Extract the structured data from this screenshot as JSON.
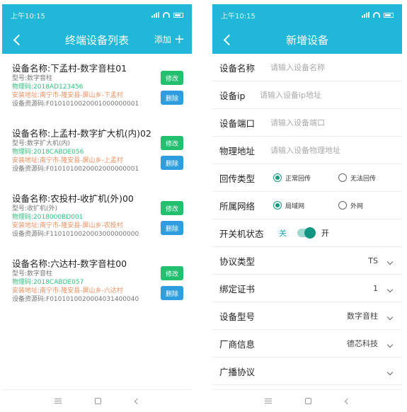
{
  "left": {
    "status_time": "上午10:15",
    "title": "终端设备列表",
    "add_label": "添加",
    "edit_label": "修改",
    "delete_label": "删除",
    "devices": [
      {
        "name": "设备名称:下孟村-数字音柱01",
        "model": "型号:数字音柱",
        "mac": "物理码:2018AD123456",
        "address": "安装地址:南宁市-隆安县-屏山乡-下孟村",
        "resource": "设备资源码:F0101010020001000000001"
      },
      {
        "name": "设备名称:上孟村-数字扩大机(内)02",
        "model": "型号:数字扩大机(内)",
        "mac": "物理码:2018CABDE056",
        "address": "安装地址:南宁市-隆安县-屏山乡-上孟村",
        "resource": "设备资源码:F0101010020002000000001"
      },
      {
        "name": "设备名称:农投村-收扩机(外)00",
        "model": "型号:收扩机(外)",
        "mac": "物理码:2018000BD001",
        "address": "安装地址:南宁市-隆安县-屏山乡-农投村",
        "resource": "设备资源码:F1101010020003000000000"
      },
      {
        "name": "设备名称:六达村-数字音柱00",
        "model": "型号:数字音柱",
        "mac": "物理码:2018CABDE057",
        "address": "安装地址:南宁市-隆安县-屏山乡-六达村",
        "resource": "设备资源码:F0101010020004031400040"
      }
    ]
  },
  "right": {
    "status_time": "上午10:15",
    "title": "新增设备",
    "fields": {
      "name": {
        "label": "设备名称",
        "placeholder": "请输入设备名称"
      },
      "ip": {
        "label": "设备ip",
        "placeholder": "请输入设备ip地址"
      },
      "port": {
        "label": "设备端口",
        "placeholder": "请输入设备端口"
      },
      "mac": {
        "label": "物理地址",
        "placeholder": "请输入设备物理地址"
      }
    },
    "feedback": {
      "label": "回传类型",
      "option_a": "正常回传",
      "option_b": "无法回传",
      "selected": "正常回传"
    },
    "network": {
      "label": "所属网络",
      "option_a": "局域网",
      "option_b": "外网",
      "selected": "局域网"
    },
    "power": {
      "label": "开关机状态",
      "off_label": "关",
      "on_label": "开",
      "state": "on"
    },
    "protocol_type": {
      "label": "协议类型",
      "value": "TS"
    },
    "certificate": {
      "label": "绑定证书",
      "value": "1"
    },
    "device_model": {
      "label": "设备型号",
      "value": "数字音柱"
    },
    "vendor": {
      "label": "厂商信息",
      "value": "德芯科技"
    },
    "broadcast_protocol": {
      "label": "广播协议",
      "value": ""
    }
  },
  "colors": {
    "accent": "#21b7d8",
    "edit": "#23c070",
    "delete": "#2e9ee0",
    "mac_text": "#2ec47f",
    "address_text": "#ee8f5f",
    "radio_on": "#159a7f"
  },
  "icons": [
    "back-arrow-icon",
    "plus-icon",
    "signal-icon",
    "wifi-icon",
    "battery-icon",
    "menu-icon",
    "home-icon",
    "nav-back-icon",
    "chevron-down-icon"
  ]
}
